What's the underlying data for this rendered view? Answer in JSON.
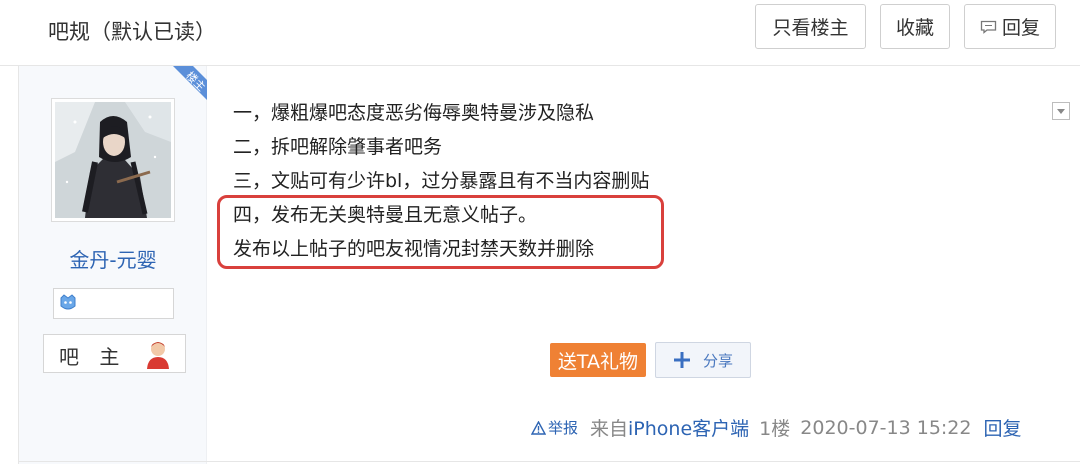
{
  "header": {
    "thread_title": "吧规（默认已读）",
    "only_owner_label": "只看楼主",
    "favorite_label": "收藏",
    "reply_label": "回复"
  },
  "post": {
    "ribbon_label": "楼主",
    "author": {
      "username": "金丹-元婴",
      "role": "吧 主"
    },
    "content_lines": [
      "一，爆粗爆吧态度恶劣侮辱奥特曼涉及隐私",
      "二，拆吧解除肇事者吧务",
      "三，文贴可有少许bl，过分暴露且有不当内容删贴",
      "四，发布无关奥特曼且无意义帖子。",
      "发布以上帖子的吧友视情况封禁天数并删除"
    ],
    "gift_label": "送TA礼物",
    "share_label": "分享",
    "meta": {
      "report_label": "举报",
      "from_prefix": "来自",
      "client": "iPhone客户端",
      "floor": "1楼",
      "timestamp": "2020-07-13 15:22",
      "reply_label": "回复"
    }
  },
  "colors": {
    "link_blue": "#2d64b3",
    "gift_orange": "#ef8134",
    "highlight_red": "#d9403c",
    "ribbon_blue": "#5b8fd9"
  }
}
